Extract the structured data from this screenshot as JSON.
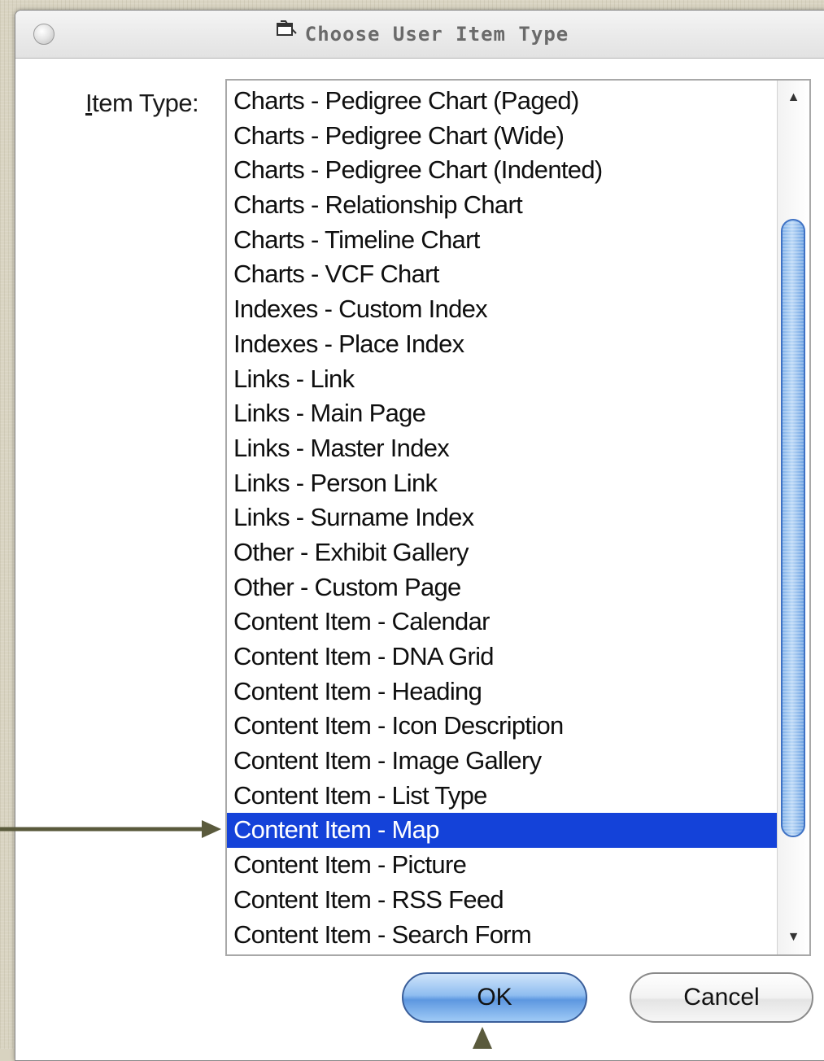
{
  "window": {
    "title": "Choose User Item Type"
  },
  "field": {
    "label_mnemonic": "I",
    "label_rest": "tem Type:"
  },
  "list": {
    "items": [
      "Charts - Pedigree Chart (Paged)",
      "Charts - Pedigree Chart (Wide)",
      "Charts - Pedigree Chart (Indented)",
      "Charts - Relationship Chart",
      "Charts - Timeline Chart",
      "Charts - VCF Chart",
      "Indexes - Custom Index",
      "Indexes - Place Index",
      "Links - Link",
      "Links - Main Page",
      "Links - Master Index",
      "Links - Person Link",
      "Links - Surname Index",
      "Other - Exhibit Gallery",
      "Other - Custom Page",
      "Content Item - Calendar",
      "Content Item - DNA Grid",
      "Content Item - Heading",
      "Content Item - Icon Description",
      "Content Item - Image Gallery",
      "Content Item - List Type",
      "Content Item - Map",
      "Content Item - Picture",
      "Content Item - RSS Feed",
      "Content Item - Search Form"
    ],
    "selected": "Content Item - Map"
  },
  "buttons": {
    "ok": "OK",
    "cancel": "Cancel"
  },
  "colors": {
    "selection": "#1442d9",
    "annotation_arrow": "#5a5a3c",
    "ok_button": "#8fbdf0"
  },
  "icons": {
    "title": "window-icon",
    "close": "close-circle-icon",
    "scroll_up": "arrow-up-icon",
    "scroll_down": "arrow-down-icon"
  }
}
